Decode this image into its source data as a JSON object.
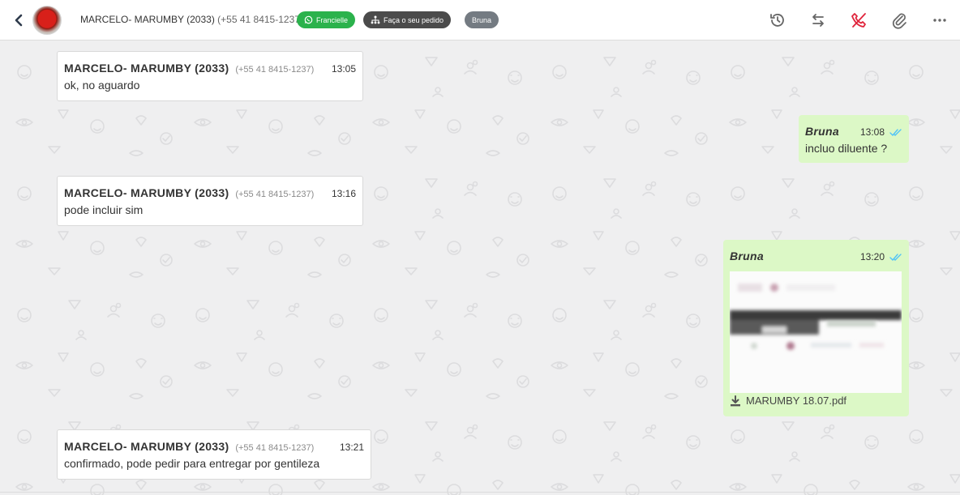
{
  "header": {
    "contact_name": "MARCELO- MARUMBY (2033)",
    "contact_phone": "(+55 41 8415-1237)",
    "tags": [
      {
        "label": "Francielle",
        "icon": "whatsapp-icon",
        "color": "#2bb24c"
      },
      {
        "label": "Faça o seu pedido",
        "icon": "sitemap-icon",
        "color": "#4b4b4b"
      },
      {
        "label": "Bruna",
        "color": "#747b82"
      }
    ],
    "actions": [
      "history-icon",
      "transfer-icon",
      "end-call-icon",
      "attach-icon",
      "more-icon"
    ]
  },
  "messages": [
    {
      "direction": "in",
      "sender": "MARCELO- MARUMBY (2033)",
      "phone": "(+55 41 8415-1237)",
      "time": "13:05",
      "text": "ok, no aguardo"
    },
    {
      "direction": "out",
      "sender": "Bruna",
      "time": "13:08",
      "text": "incluo diluente ?"
    },
    {
      "direction": "in",
      "sender": "MARCELO- MARUMBY (2033)",
      "phone": "(+55 41 8415-1237)",
      "time": "13:16",
      "text": "pode incluir sim"
    },
    {
      "direction": "out",
      "sender": "Bruna",
      "time": "13:20",
      "attachment": "MARUMBY 18.07.pdf"
    },
    {
      "direction": "in",
      "sender": "MARCELO- MARUMBY (2033)",
      "phone": "(+55 41 8415-1237)",
      "time": "13:21",
      "text": "confirmado, pode pedir para entregar por gentileza"
    }
  ],
  "colors": {
    "incoming_bubble": "#ffffff",
    "outgoing_bubble": "#dcf8c6",
    "read_ticks": "#4fc3f7",
    "accent_red": "#e0243c"
  }
}
